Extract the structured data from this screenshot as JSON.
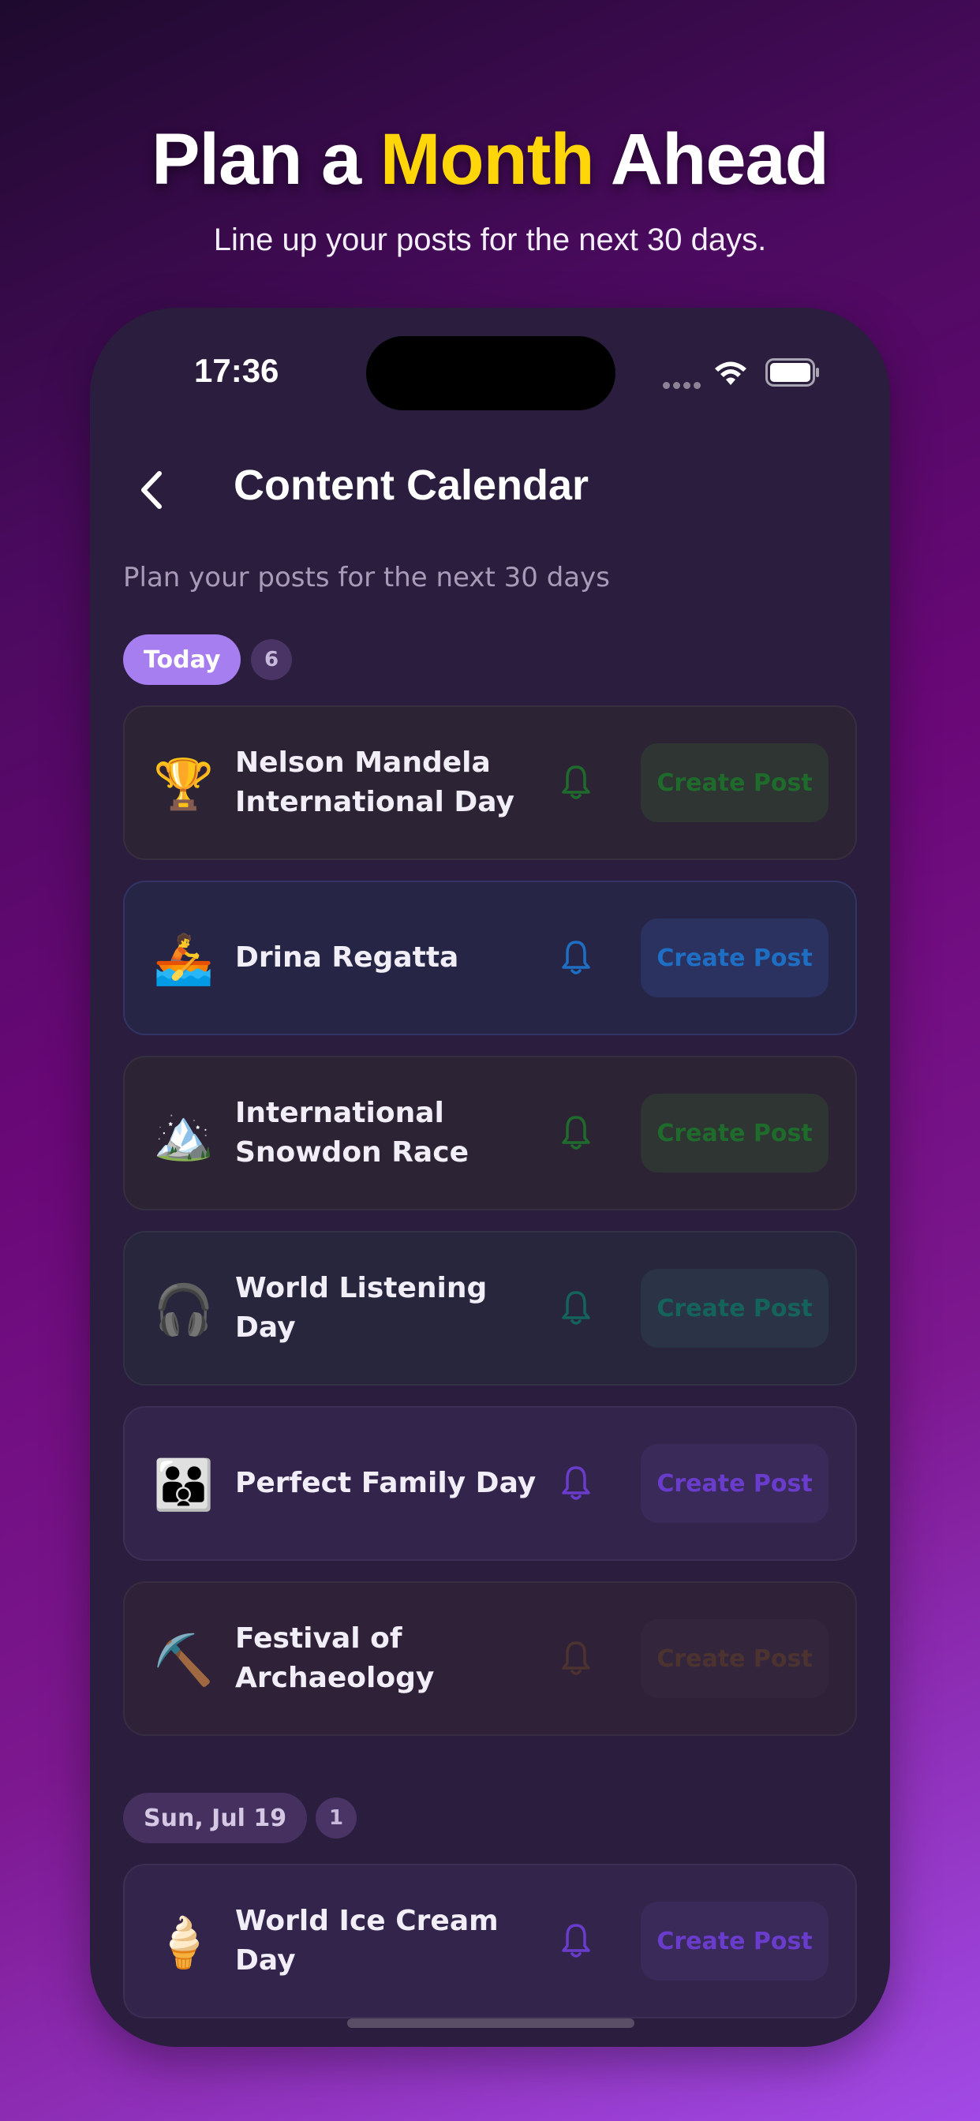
{
  "promo": {
    "headline_pre": "Plan a ",
    "headline_accent": "Month",
    "headline_post": " Ahead",
    "subhead": "Line up your posts for the next 30 days."
  },
  "status_bar": {
    "time": "17:36"
  },
  "header": {
    "title": "Content Calendar",
    "subtitle": "Plan your posts for the next 30 days"
  },
  "sections": [
    {
      "label": "Today",
      "count": "6",
      "items": [
        {
          "emoji": "🏆",
          "title": "Nelson Mandela International Day",
          "cta": "Create Post",
          "tint": "green"
        },
        {
          "emoji": "🚣",
          "title": "Drina Regatta",
          "cta": "Create Post",
          "tint": "blue"
        },
        {
          "emoji": "🏔️",
          "title": "International Snowdon Race",
          "cta": "Create Post",
          "tint": "green"
        },
        {
          "emoji": "🎧",
          "title": "World Listening Day",
          "cta": "Create Post",
          "tint": "teal"
        },
        {
          "emoji": "👪",
          "title": "Perfect Family Day",
          "cta": "Create Post",
          "tint": "purple"
        },
        {
          "emoji": "⛏️",
          "title": "Festival of Archaeology",
          "cta": "Create Post",
          "tint": "brown"
        }
      ]
    },
    {
      "label": "Sun, Jul 19",
      "count": "1",
      "items": [
        {
          "emoji": "🍦",
          "title": "World Ice Cream Day",
          "cta": "Create Post",
          "tint": "purple"
        }
      ]
    }
  ],
  "colors": {
    "accent_yellow": "#ffd60a",
    "today_pill": "#a77ef0",
    "green": "#1f6b2c",
    "blue": "#1e6fc4",
    "teal": "#15645c",
    "purple": "#6a3ccc",
    "brown": "#4d3330"
  }
}
